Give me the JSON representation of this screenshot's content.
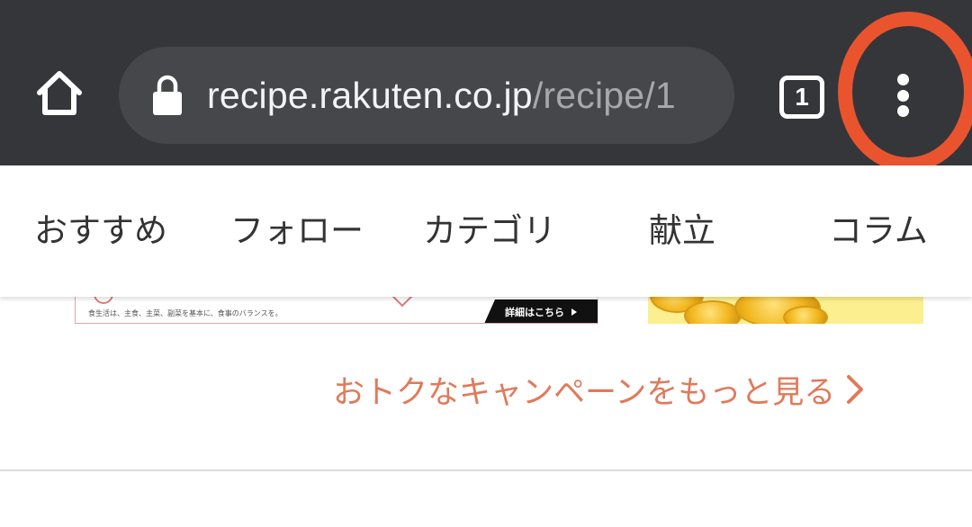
{
  "browser": {
    "url_domain": "recipe.rakuten.co.jp",
    "url_path": "/recipe/1",
    "tab_count": "1"
  },
  "nav": {
    "tabs": [
      {
        "label": "おすすめ"
      },
      {
        "label": "フォロー"
      },
      {
        "label": "カテゴリ"
      },
      {
        "label": "献立"
      },
      {
        "label": "コラム"
      }
    ]
  },
  "banner": {
    "fine_print": "食生活は、主食、主菜、副菜を基本に、食事のバランスを。",
    "detail_label": "詳細はこちら"
  },
  "campaign": {
    "more_label": "おトクなキャンペーンをもっと見る"
  },
  "colors": {
    "toolbar": "#35363a",
    "highlight": "#e9542f",
    "link": "#e07a5a"
  },
  "icons": [
    "home-icon",
    "lock-icon",
    "tab-switcher-icon",
    "more-vert-icon",
    "chevron-right-icon"
  ]
}
